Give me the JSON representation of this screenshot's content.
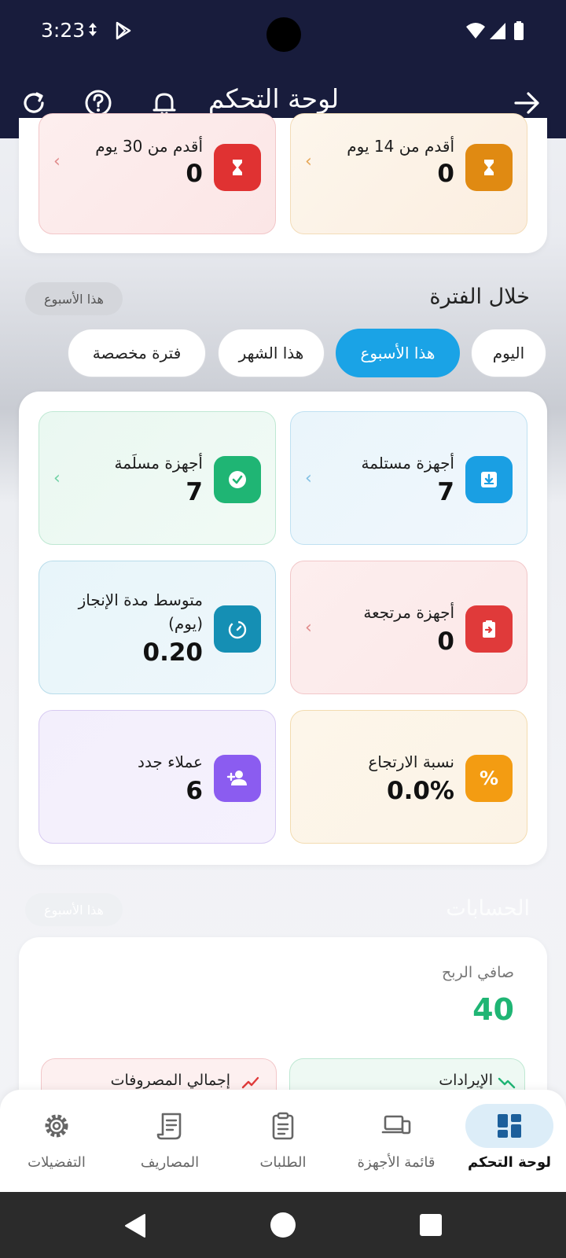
{
  "status_bar": {
    "time": "3:23"
  },
  "app_bar": {
    "title": "لوحة التحكم"
  },
  "aging": {
    "items": [
      {
        "label": "أقدم من 14 يوم",
        "value": "0"
      },
      {
        "label": "أقدم من 30 يوم",
        "value": "0"
      }
    ]
  },
  "period": {
    "title": "خلال الفترة",
    "chip": "هذا الأسبوع",
    "tabs": [
      "اليوم",
      "هذا الأسبوع",
      "هذا الشهر",
      "فترة مخصصة"
    ],
    "stats": [
      {
        "label": "أجهزة مستلمة",
        "value": "7"
      },
      {
        "label": "أجهزة مسلَمة",
        "value": "7"
      },
      {
        "label": "أجهزة مرتجعة",
        "value": "0"
      },
      {
        "label": "متوسط مدة الإنجاز (يوم)",
        "value": "0.20"
      },
      {
        "label": "نسبة الارتجاع",
        "value": "0.0%"
      },
      {
        "label": "عملاء جدد",
        "value": "6"
      }
    ]
  },
  "accounts": {
    "title": "الحسابات",
    "chip": "هذا الأسبوع",
    "net_profit_label": "صافي الربح",
    "net_profit_value": "40",
    "revenue_label": "الإيرادات",
    "expenses_label": "إجمالي المصروفات"
  },
  "bottom_nav": {
    "items": [
      "لوحة التحكم",
      "قائمة الأجهزة",
      "الطلبات",
      "المصاريف",
      "التفضيلات"
    ]
  },
  "colors": {
    "primary": "#181c3c",
    "accent": "#1aa3e6",
    "profit": "#1fb574"
  }
}
